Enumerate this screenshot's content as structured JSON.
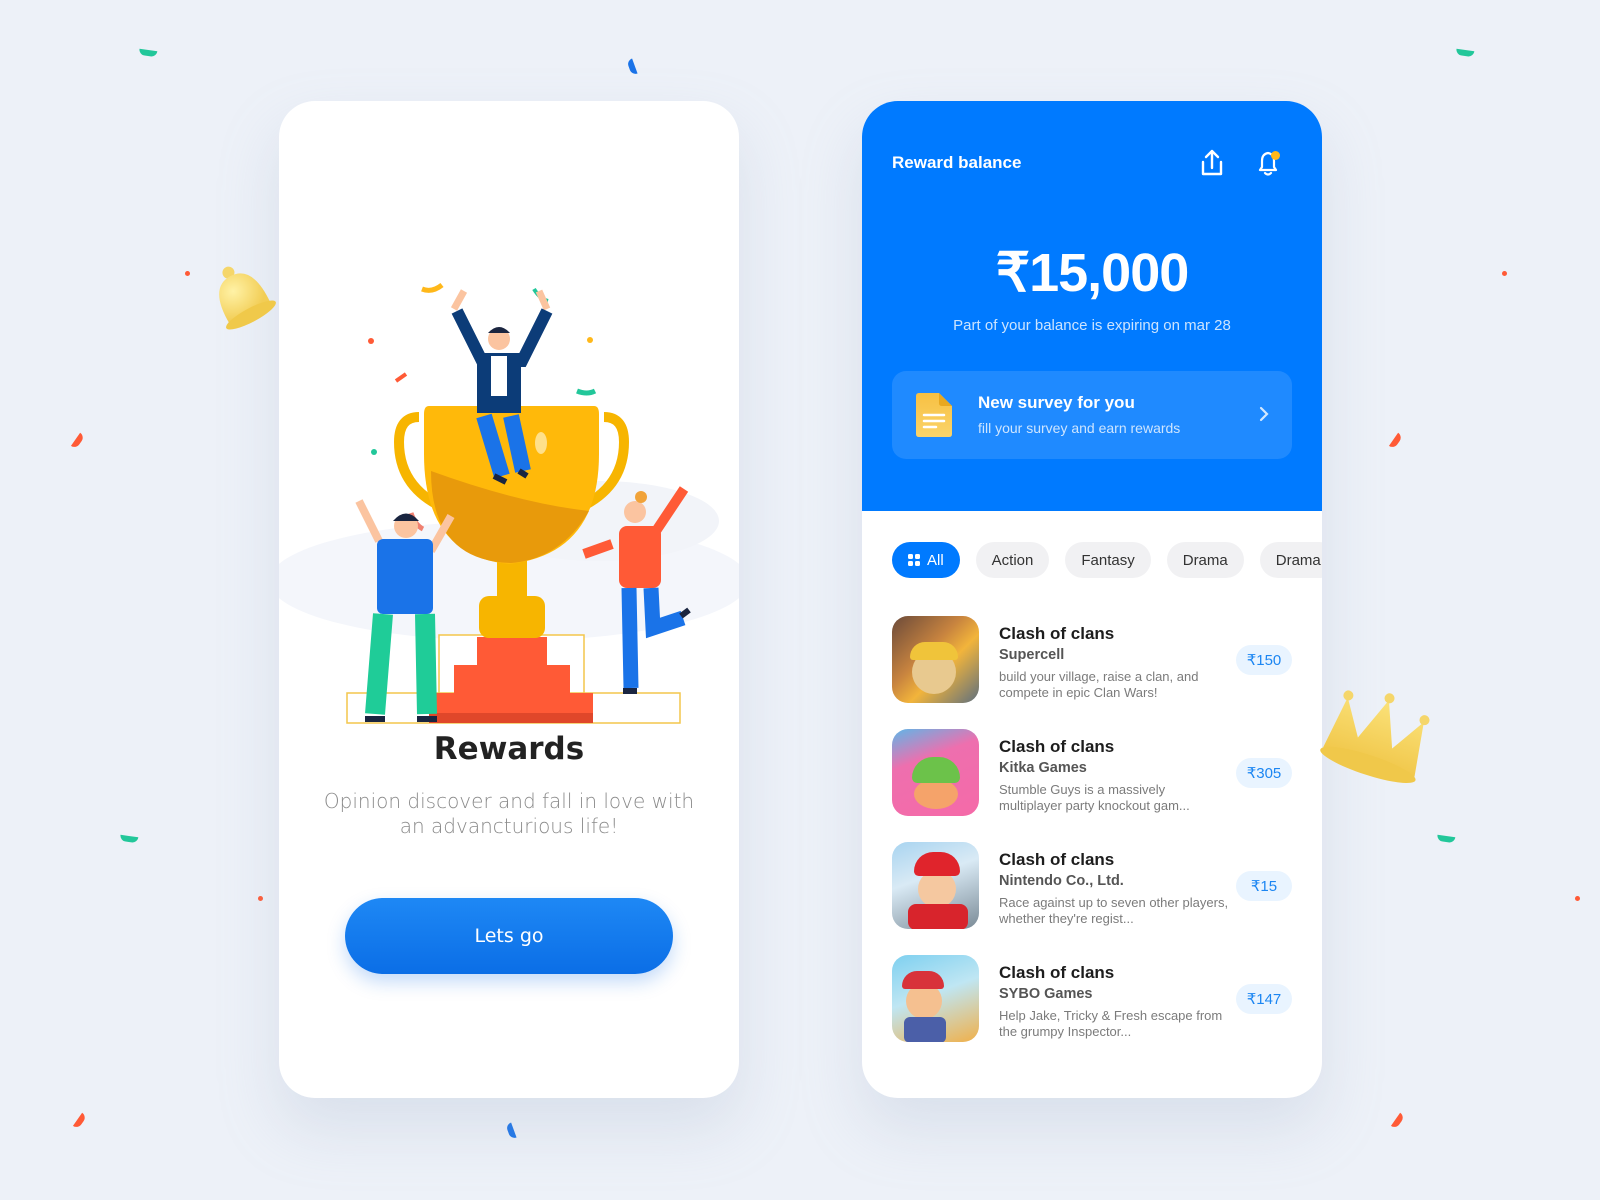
{
  "onboarding": {
    "title": "Rewards",
    "subtitle": "Opinion discover and fall in love with an advancturious life!",
    "cta_label": "Lets go"
  },
  "wallet": {
    "header_title": "Reward balance",
    "icons": {
      "share": "share-icon",
      "notifications": "bell-icon"
    },
    "has_unread_notification": true,
    "balance": "₹15,000",
    "expiry_notice": "Part of your balance is expiring on mar 28",
    "survey_banner": {
      "title": "New survey for you",
      "subtitle": "fill your survey and earn rewards",
      "icon": "document-icon"
    },
    "categories": [
      {
        "label": "All",
        "active": true,
        "icon": "grid-icon"
      },
      {
        "label": "Action",
        "active": false
      },
      {
        "label": "Fantasy",
        "active": false
      },
      {
        "label": "Drama",
        "active": false
      },
      {
        "label": "Drama",
        "active": false
      }
    ],
    "games": [
      {
        "title": "Clash of clans",
        "developer": "Supercell",
        "description": "build your village, raise a clan, and compete in epic Clan Wars!",
        "reward": "₹150"
      },
      {
        "title": "Clash of clans",
        "developer": "Kitka Games",
        "description": "Stumble Guys is a massively multiplayer party knockout gam...",
        "reward": "₹305"
      },
      {
        "title": "Clash of clans",
        "developer": "Nintendo Co., Ltd.",
        "description": "Race against up to seven other players, whether they're regist...",
        "reward": "₹15"
      },
      {
        "title": "Clash of clans",
        "developer": "SYBO Games",
        "description": "Help Jake, Tricky & Fresh escape from the grumpy Inspector...",
        "reward": "₹147"
      }
    ]
  },
  "colors": {
    "primary": "#007aff",
    "background": "#edf1f8",
    "accent_yellow": "#ffb81a",
    "price_bg": "#e9f4ff",
    "price_text": "#1c86f2"
  }
}
